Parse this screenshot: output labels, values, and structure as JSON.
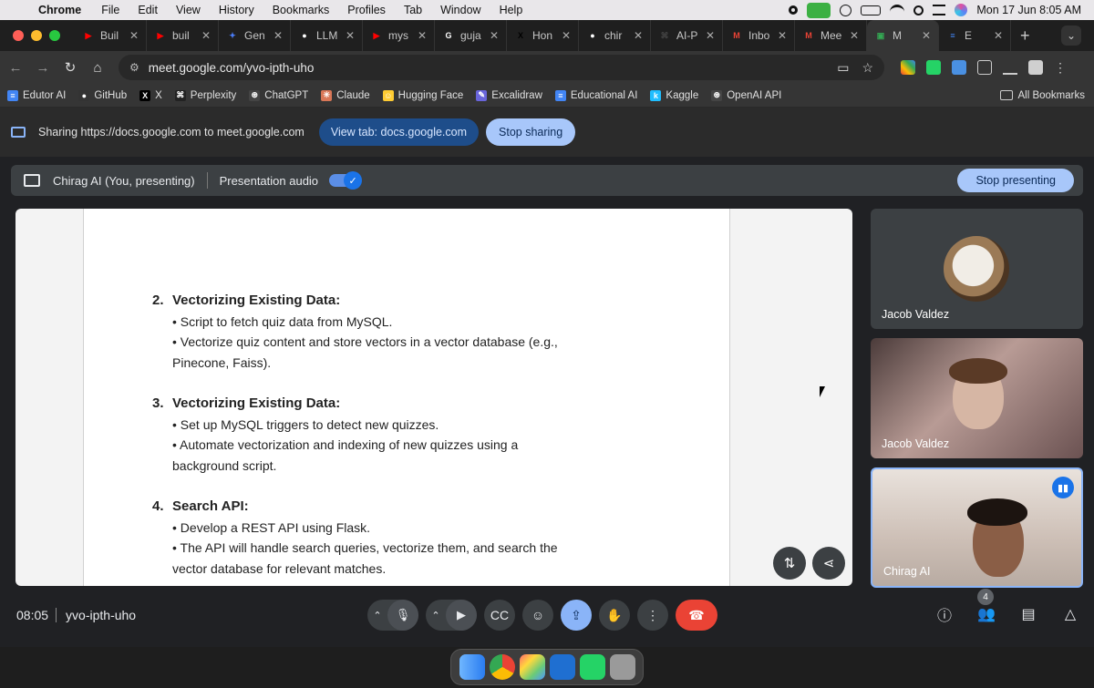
{
  "menubar": {
    "app": "Chrome",
    "items": [
      "File",
      "Edit",
      "View",
      "History",
      "Bookmarks",
      "Profiles",
      "Tab",
      "Window",
      "Help"
    ],
    "clock": "Mon 17 Jun  8:05 AM"
  },
  "tabs": [
    {
      "title": "Buil",
      "color": "#ff0000",
      "glyph": "▶"
    },
    {
      "title": "buil",
      "color": "#ff0000",
      "glyph": "▶"
    },
    {
      "title": "Gen",
      "color": "#4a7cf7",
      "glyph": "✦"
    },
    {
      "title": "LLM",
      "color": "#ffffff",
      "glyph": "●"
    },
    {
      "title": "mys",
      "color": "#ff0000",
      "glyph": "▶"
    },
    {
      "title": "guja",
      "color": "#ffffff",
      "glyph": "G"
    },
    {
      "title": "Hon",
      "color": "#000000",
      "glyph": "X"
    },
    {
      "title": "chir",
      "color": "#ffffff",
      "glyph": "●"
    },
    {
      "title": "AI-P",
      "color": "#444444",
      "glyph": "⌘"
    },
    {
      "title": "Inbo",
      "color": "#ea4335",
      "glyph": "M"
    },
    {
      "title": "Mee",
      "color": "#ea4335",
      "glyph": "M"
    },
    {
      "title": "M",
      "color": "#34a853",
      "glyph": "▣",
      "active": true
    },
    {
      "title": "E",
      "color": "#4285f4",
      "glyph": "≡"
    }
  ],
  "address": {
    "url": "meet.google.com/yvo-ipth-uho"
  },
  "bookmarks": [
    {
      "label": "Edutor AI",
      "color": "#4285f4",
      "glyph": "≡"
    },
    {
      "label": "GitHub",
      "color": "#333",
      "glyph": "●"
    },
    {
      "label": "X",
      "color": "#000",
      "glyph": "X"
    },
    {
      "label": "Perplexity",
      "color": "#222",
      "glyph": "⌘"
    },
    {
      "label": "ChatGPT",
      "color": "#444",
      "glyph": "⊛"
    },
    {
      "label": "Claude",
      "color": "#d97757",
      "glyph": "✳"
    },
    {
      "label": "Hugging Face",
      "color": "#ffcc33",
      "glyph": "☺"
    },
    {
      "label": "Excalidraw",
      "color": "#6965db",
      "glyph": "✎"
    },
    {
      "label": "Educational AI",
      "color": "#4285f4",
      "glyph": "≡"
    },
    {
      "label": "Kaggle",
      "color": "#20beff",
      "glyph": "k"
    },
    {
      "label": "OpenAI API",
      "color": "#444",
      "glyph": "⊛"
    }
  ],
  "bookmarks_all": "All Bookmarks",
  "sharebar": {
    "text": "Sharing https://docs.google.com to meet.google.com",
    "view_tab": "View tab: docs.google.com",
    "stop_sharing": "Stop sharing"
  },
  "presentbar": {
    "presenter": "Chirag AI (You, presenting)",
    "audio": "Presentation audio",
    "stop": "Stop presenting"
  },
  "doc": {
    "sections": [
      {
        "num": "2.",
        "title": "Vectorizing Existing Data:",
        "bullets": [
          "• Script to fetch quiz data from MySQL.",
          "• Vectorize quiz content and store vectors in a vector database (e.g., Pinecone, Faiss)."
        ]
      },
      {
        "num": "3.",
        "title": "Vectorizing Existing Data:",
        "bullets": [
          "• Set up MySQL triggers to detect new quizzes.",
          "• Automate vectorization and indexing of new quizzes using a background script."
        ]
      },
      {
        "num": "4.",
        "title": "Search API:",
        "bullets": [
          "• Develop a REST API using Flask.",
          "• The API will handle search queries, vectorize them, and search the vector database for relevant matches."
        ]
      }
    ]
  },
  "participants": [
    {
      "name": "Jacob Valdez"
    },
    {
      "name": "Jacob Valdez"
    },
    {
      "name": "Chirag AI"
    }
  ],
  "bottom": {
    "time": "08:05",
    "code": "yvo-ipth-uho",
    "people_count": "4"
  },
  "icons": {
    "close": "close-icon",
    "mic": "mic-icon",
    "camera": "camera-icon"
  }
}
